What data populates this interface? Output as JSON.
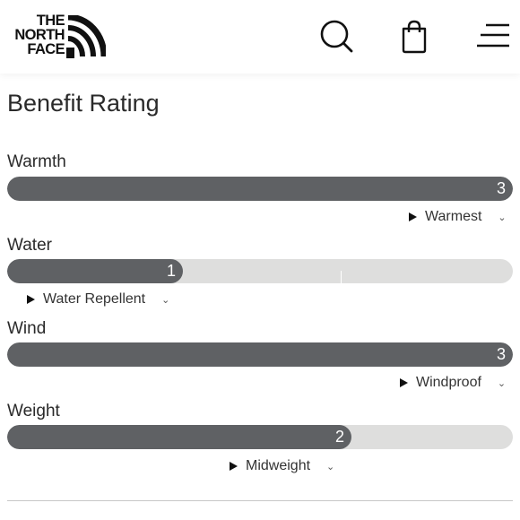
{
  "header": {
    "logo_lines": [
      "THE",
      "NORTH",
      "FACE"
    ],
    "icons": [
      "search-icon",
      "shopping-bag-icon",
      "hamburger-menu-icon"
    ]
  },
  "section": {
    "title": "Benefit Rating"
  },
  "ratings": [
    {
      "label": "Warmth",
      "value": "3",
      "level": 3,
      "max": 3,
      "option": "Warmest"
    },
    {
      "label": "Water",
      "value": "1",
      "level": 1,
      "max": 3,
      "option": "Water Repellent"
    },
    {
      "label": "Wind",
      "value": "3",
      "level": 3,
      "max": 3,
      "option": "Windproof"
    },
    {
      "label": "Weight",
      "value": "2",
      "level": 2,
      "max": 3,
      "option": "Midweight"
    }
  ],
  "colors": {
    "bar_fill": "#5f6164",
    "bar_track": "#dededd",
    "text": "#2a2a2a"
  }
}
